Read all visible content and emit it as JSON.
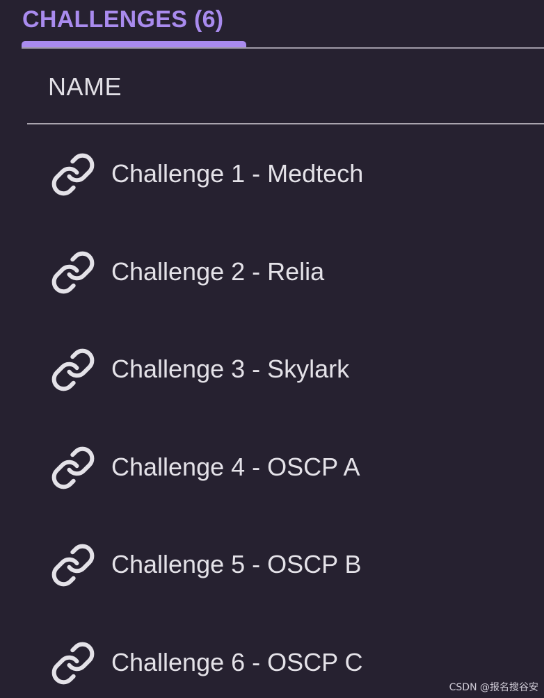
{
  "tabs": {
    "title": "CHALLENGES (6)",
    "accent_color": "#a98bee"
  },
  "table": {
    "column_header": "NAME",
    "rows": [
      {
        "icon": "link-icon",
        "label": "Challenge 1 - Medtech"
      },
      {
        "icon": "link-icon",
        "label": "Challenge 2 - Relia"
      },
      {
        "icon": "link-icon",
        "label": "Challenge 3 - Skylark"
      },
      {
        "icon": "link-icon",
        "label": "Challenge 4 - OSCP A"
      },
      {
        "icon": "link-icon",
        "label": "Challenge 5 - OSCP B"
      },
      {
        "icon": "link-icon",
        "label": "Challenge 6 - OSCP C"
      }
    ]
  },
  "watermark": "CSDN @报名搜谷安",
  "colors": {
    "background": "#262130",
    "text": "#e4e2e8",
    "divider": "#a9a4ae"
  }
}
